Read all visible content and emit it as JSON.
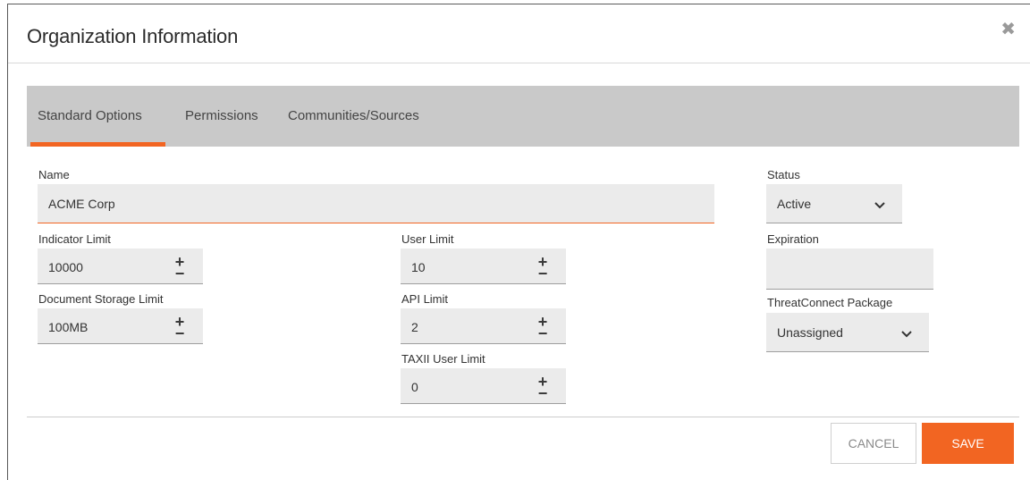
{
  "dialog": {
    "title": "Organization Information"
  },
  "tabs": [
    {
      "label": "Standard Options",
      "active": true
    },
    {
      "label": "Permissions",
      "active": false
    },
    {
      "label": "Communities/Sources",
      "active": false
    }
  ],
  "form": {
    "name": {
      "label": "Name",
      "value": "ACME Corp"
    },
    "indicator_limit": {
      "label": "Indicator Limit",
      "value": "10000"
    },
    "document_storage_limit": {
      "label": "Document Storage Limit",
      "value": "100MB"
    },
    "user_limit": {
      "label": "User Limit",
      "value": "10"
    },
    "api_limit": {
      "label": "API Limit",
      "value": "2"
    },
    "taxii_user_limit": {
      "label": "TAXII User Limit",
      "value": "0"
    },
    "status": {
      "label": "Status",
      "value": "Active"
    },
    "expiration": {
      "label": "Expiration",
      "value": ""
    },
    "threatconnect_package": {
      "label": "ThreatConnect Package",
      "value": "Unassigned"
    }
  },
  "stepper": {
    "plus": "+",
    "minus": "−"
  },
  "icons": {
    "close": "close-icon",
    "chevron": "chevron-down-icon"
  },
  "footer": {
    "cancel_label": "CANCEL",
    "save_label": "SAVE"
  },
  "colors": {
    "accent": "#f26522",
    "tabbar": "#c9c9c9",
    "field_bg": "#ebebeb"
  }
}
